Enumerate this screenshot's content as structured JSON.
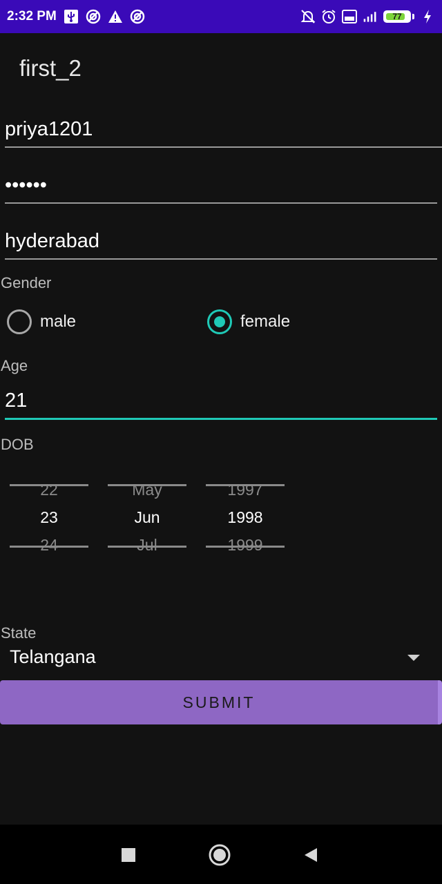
{
  "status_bar": {
    "time": "2:32 PM",
    "battery_level": "77",
    "left_icons": [
      "usb-icon",
      "sync-icon",
      "warning-icon",
      "sync-icon"
    ],
    "right_icons": [
      "bell-off-icon",
      "alarm-icon",
      "volte-icon",
      "signal-icon",
      "battery-icon",
      "charging-icon"
    ]
  },
  "app": {
    "title": "first_2"
  },
  "form": {
    "username": "priya1201",
    "password": "••••••",
    "city": "hyderabad",
    "gender_label": "Gender",
    "gender_options": [
      {
        "label": "male",
        "checked": false
      },
      {
        "label": "female",
        "checked": true
      }
    ],
    "age_label": "Age",
    "age": "21",
    "dob_label": "DOB",
    "dob": {
      "day": {
        "prev": "22",
        "selected": "23",
        "next": "24"
      },
      "month": {
        "prev": "May",
        "selected": "Jun",
        "next": "Jul"
      },
      "year": {
        "prev": "1997",
        "selected": "1998",
        "next": "1999"
      }
    },
    "state_label": "State",
    "state": "Telangana",
    "submit_label": "SUBMIT"
  },
  "colors": {
    "status_bar": "#3a0ab8",
    "background": "#121212",
    "accent": "#1fc9b6",
    "button": "#8e67c4"
  }
}
